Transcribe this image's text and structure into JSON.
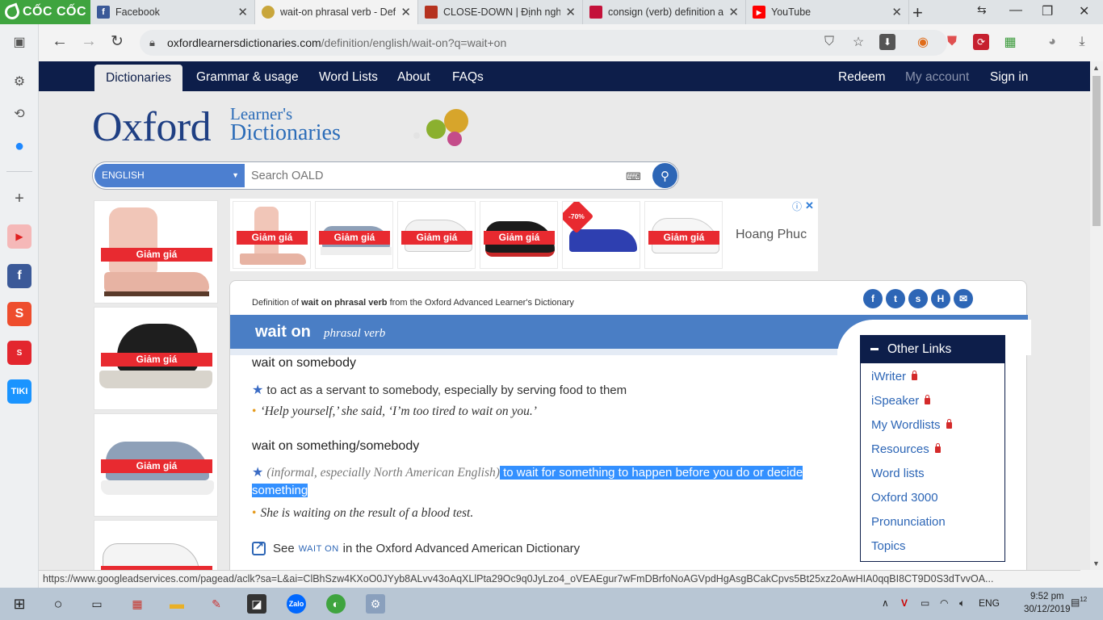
{
  "browser": {
    "logo_text": "CỐC CỐC",
    "tabs": [
      {
        "title": "Facebook",
        "fav_letter": "f",
        "fav_color": "#3b5998"
      },
      {
        "title": "wait-on phrasal verb - Defin",
        "fav_letter": "●",
        "fav_color": "#c9a63b"
      },
      {
        "title": "CLOSE-DOWN | Định nghĩa",
        "fav_letter": "■",
        "fav_color": "#b5321f"
      },
      {
        "title": "consign (verb) definition an",
        "fav_letter": "▲",
        "fav_color": "#c4123a"
      },
      {
        "title": "YouTube",
        "fav_letter": "▶",
        "fav_color": "#ff0000"
      }
    ],
    "url_host": "oxfordlearnersdictionaries.com",
    "url_path": "/definition/english/wait-on?q=wait+on",
    "status_url": "https://www.googleadservices.com/pagead/aclk?sa=L&ai=ClBhSzw4KXoO0JYyb8ALvv43oAqXLlPta29Oc9q0JyLzo4_oVEAEgur7wFmDBrfoNoAGVpdHgAsgBCakCpvs5Bt25xz2oAwHIA0qqBI8CT9D0S3dTvvOA..."
  },
  "site_nav": {
    "items": [
      "Dictionaries",
      "Grammar & usage",
      "Word Lists",
      "About",
      "FAQs"
    ],
    "right": [
      "Redeem",
      "My account",
      "Sign in"
    ]
  },
  "logo": {
    "oxford": "Oxford",
    "line1": "Learner's",
    "line2": "Dictionaries"
  },
  "search": {
    "language": "ENGLISH",
    "placeholder": "Search OALD"
  },
  "ads": {
    "sale_label": "Giảm giá",
    "badge": "-70%",
    "brand": "Hoang Phuc"
  },
  "entry": {
    "definition_of_prefix": "Definition of ",
    "definition_of_word": "wait on phrasal verb",
    "definition_of_suffix": " from the Oxford Advanced Learner's Dictionary",
    "headword": "wait on",
    "pos": "phrasal verb",
    "senses": [
      {
        "head": "wait on somebody",
        "definition": "to act as a servant to somebody, especially by serving food to them",
        "example": "‘Help yourself,’ she said, ‘I’m too tired to wait on you.’"
      },
      {
        "head": "wait on something/somebody",
        "labels": "(informal, especially North American English)",
        "definition_part1": " to wait for something to happen before you do or decide",
        "definition_part2": "something",
        "example": "She is waiting on the result of a blood test."
      }
    ],
    "see_prefix": "See",
    "see_word": "WAIT ON",
    "see_suffix": "in the Oxford Advanced American Dictionary"
  },
  "other_links": {
    "title": "Other Links",
    "items": [
      {
        "label": "iWriter",
        "locked": true
      },
      {
        "label": "iSpeaker",
        "locked": true
      },
      {
        "label": "My Wordlists",
        "locked": true
      },
      {
        "label": "Resources",
        "locked": true
      },
      {
        "label": "Word lists",
        "locked": false
      },
      {
        "label": "Oxford 3000",
        "locked": false
      },
      {
        "label": "Pronunciation",
        "locked": false
      },
      {
        "label": "Topics",
        "locked": false
      }
    ]
  },
  "taskbar": {
    "lang": "ENG",
    "time": "9:52 pm",
    "date": "30/12/2019",
    "notif_count": "12"
  },
  "colors": {
    "nav": "#0d1e4a",
    "accent": "#4a7ec5",
    "link": "#2d66b6",
    "sale": "#e82a30"
  }
}
